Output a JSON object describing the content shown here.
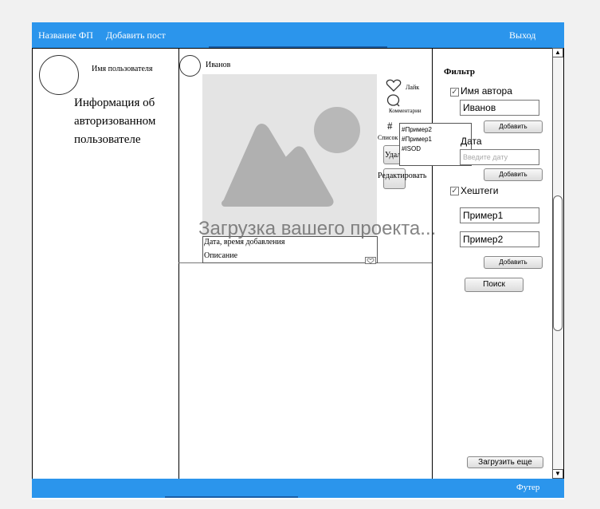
{
  "header": {
    "app_name": "Название ФП",
    "add_post": "Добавить пост",
    "logout": "Выход"
  },
  "profile": {
    "username": "Имя пользователя",
    "info": "Информация об авторизованном пользователе"
  },
  "post": {
    "author": "Иванов",
    "like_label": "Лайк",
    "comments_label": "Комментарии",
    "hashtag_symbol": "#",
    "list_label": "Список",
    "delete_label": "Удалить",
    "edit_label": "Редактировать",
    "hashtags": [
      "#Пример2",
      "#Пример1",
      "#ISOD"
    ],
    "date_time": "Дата, время добавления",
    "description": "Описание"
  },
  "loading_overlay": "Загрузка вашего проекта...",
  "filter": {
    "title": "Фильтр",
    "author_label": "Имя автора",
    "author_checked": true,
    "author_value": "Иванов",
    "add_label": "Добавить",
    "date_label": "Дата",
    "date_placeholder": "Введите дату",
    "hashtags_label": "Хештеги",
    "hashtags_checked": true,
    "hashtag_1": "Пример1",
    "hashtag_2": "Пример2",
    "search_label": "Поиск"
  },
  "load_more": "Загрузить еще",
  "footer": {
    "label": "Футер"
  },
  "colors": {
    "accent": "#2b95ec"
  }
}
